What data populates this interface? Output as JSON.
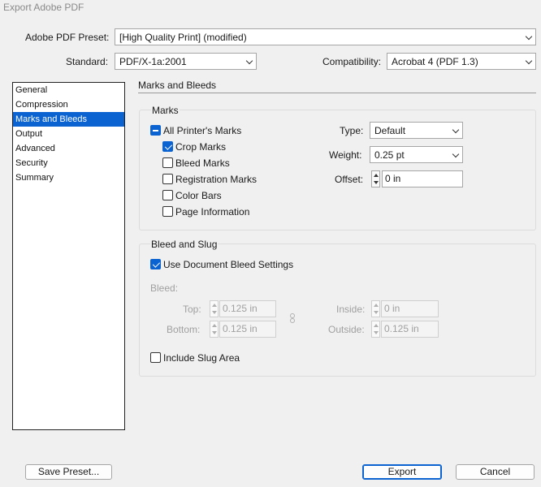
{
  "window": {
    "title": "Export Adobe PDF"
  },
  "header": {
    "preset_label": "Adobe PDF Preset:",
    "preset_value": "[High Quality Print] (modified)",
    "standard_label": "Standard:",
    "standard_value": "PDF/X-1a:2001",
    "compat_label": "Compatibility:",
    "compat_value": "Acrobat 4 (PDF 1.3)"
  },
  "sidebar": {
    "items": [
      {
        "label": "General"
      },
      {
        "label": "Compression"
      },
      {
        "label": "Marks and Bleeds"
      },
      {
        "label": "Output"
      },
      {
        "label": "Advanced"
      },
      {
        "label": "Security"
      },
      {
        "label": "Summary"
      }
    ],
    "selected": "Marks and Bleeds"
  },
  "main": {
    "section_title": "Marks and Bleeds",
    "marks": {
      "title": "Marks",
      "all_printers_marks": {
        "label": "All Printer's Marks",
        "state": "mixed"
      },
      "crop_marks": {
        "label": "Crop Marks",
        "checked": true
      },
      "bleed_marks": {
        "label": "Bleed Marks",
        "checked": false
      },
      "registration_marks": {
        "label": "Registration Marks",
        "checked": false
      },
      "color_bars": {
        "label": "Color Bars",
        "checked": false
      },
      "page_information": {
        "label": "Page Information",
        "checked": false
      },
      "type_label": "Type:",
      "type_value": "Default",
      "weight_label": "Weight:",
      "weight_value": "0.25 pt",
      "offset_label": "Offset:",
      "offset_value": "0 in"
    },
    "bleed_slug": {
      "title": "Bleed and Slug",
      "use_doc_bleed": {
        "label": "Use Document Bleed Settings",
        "checked": true
      },
      "bleed_label": "Bleed:",
      "top_label": "Top:",
      "top_value": "0.125 in",
      "bottom_label": "Bottom:",
      "bottom_value": "0.125 in",
      "inside_label": "Inside:",
      "inside_value": "0 in",
      "outside_label": "Outside:",
      "outside_value": "0.125 in",
      "include_slug": {
        "label": "Include Slug Area",
        "checked": false
      }
    }
  },
  "footer": {
    "save_preset": "Save Preset...",
    "export": "Export",
    "cancel": "Cancel"
  },
  "colors": {
    "accent": "#0a63d1",
    "disabled_text": "#a0a0a0"
  }
}
